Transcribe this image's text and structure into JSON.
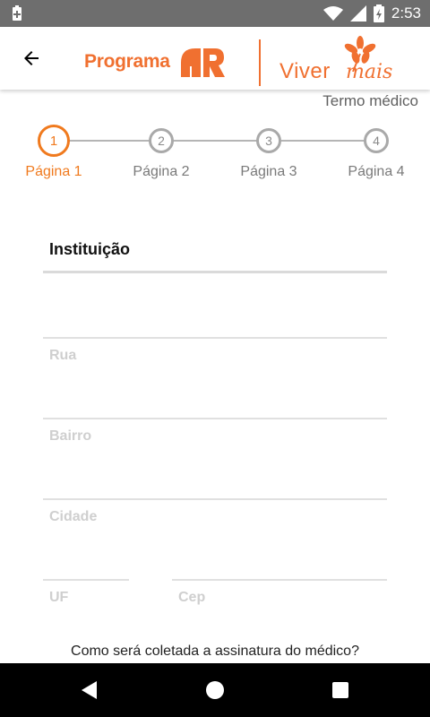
{
  "status_bar": {
    "time": "2:53",
    "icons": [
      "battery-saver-icon",
      "wifi-icon",
      "signal-icon",
      "battery-charging-icon"
    ]
  },
  "header": {
    "back_icon": "arrow-left-icon",
    "logo_programa": "Programa",
    "logo_viver": "Viver",
    "logo_mais": "mais",
    "brand_color": "#f07030"
  },
  "page_subtitle": "Termo médico",
  "stepper": {
    "active_color": "#f07a1e",
    "steps": [
      {
        "number": "1",
        "label": "Página 1",
        "active": true
      },
      {
        "number": "2",
        "label": "Página 2",
        "active": false
      },
      {
        "number": "3",
        "label": "Página 3",
        "active": false
      },
      {
        "number": "4",
        "label": "Página 4",
        "active": false
      }
    ]
  },
  "form": {
    "instituicao_value": "Instituição",
    "rua_placeholder": "Rua",
    "bairro_placeholder": "Bairro",
    "cidade_placeholder": "Cidade",
    "uf_placeholder": "UF",
    "cep_placeholder": "Cep"
  },
  "question": "Como será coletada a assinatura do médico?",
  "nav_bar": {
    "icons": [
      "back-triangle-icon",
      "home-circle-icon",
      "recents-square-icon"
    ]
  }
}
